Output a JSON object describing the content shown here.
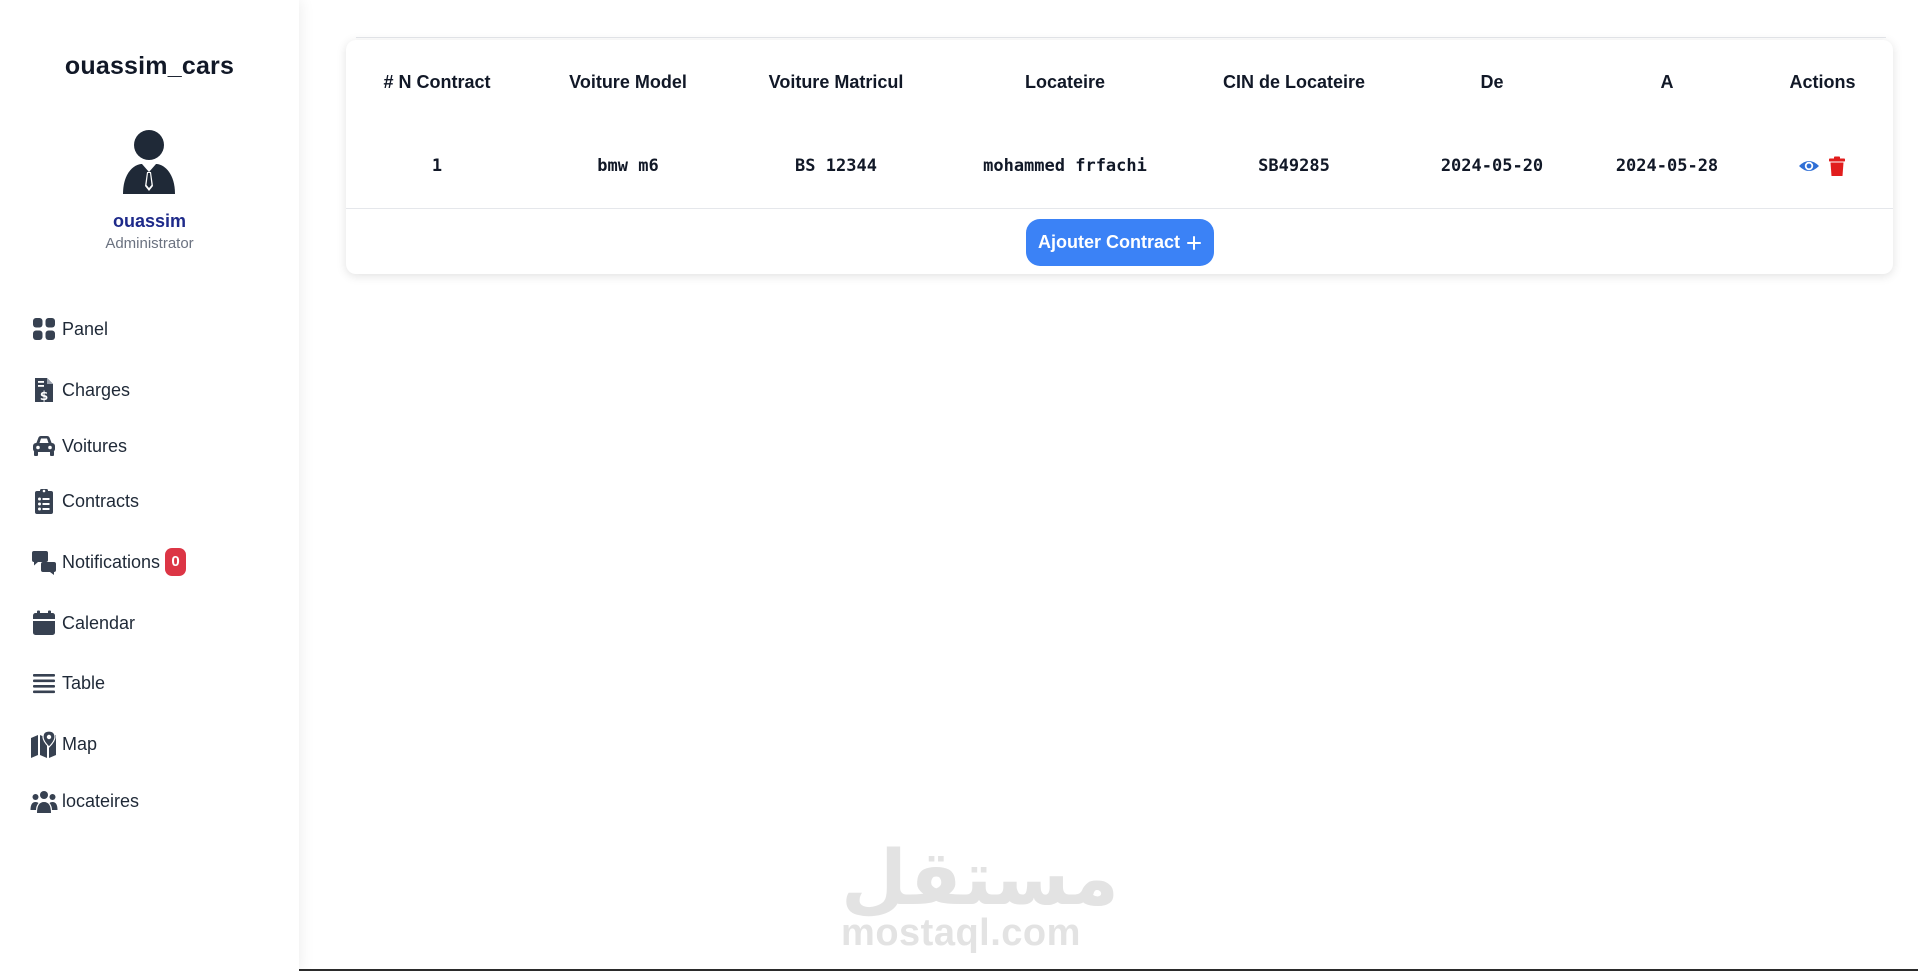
{
  "app": {
    "brand": "ouassim_cars"
  },
  "user": {
    "name": "ouassim",
    "role": "Administrator"
  },
  "sidebar": {
    "items": [
      {
        "label": "Panel",
        "icon": "grid-icon"
      },
      {
        "label": "Charges",
        "icon": "invoice-dollar-icon"
      },
      {
        "label": "Voitures",
        "icon": "car-icon"
      },
      {
        "label": "Contracts",
        "icon": "clipboard-list-icon"
      },
      {
        "label": "Notifications",
        "icon": "comments-icon",
        "badge": "0"
      },
      {
        "label": "Calendar",
        "icon": "calendar-icon"
      },
      {
        "label": "Table",
        "icon": "list-lines-icon"
      },
      {
        "label": "Map",
        "icon": "map-location-icon"
      },
      {
        "label": "locateires",
        "icon": "users-icon"
      }
    ]
  },
  "table": {
    "headers": [
      "# N Contract",
      "Voiture Model",
      "Voiture Matricul",
      "Locateire",
      "CIN de Locateire",
      "De",
      "A",
      "Actions"
    ],
    "rows": [
      [
        "1",
        "bmw m6",
        "BS 12344",
        "mohammed frfachi",
        "SB49285",
        "2024-05-20",
        "2024-05-28"
      ]
    ],
    "actions": [
      "eye-icon",
      "trash-icon"
    ]
  },
  "buttons": {
    "add_contract": "Ajouter Contract"
  },
  "watermark": {
    "arabic": "مستقل",
    "latin": "mostaql.com"
  },
  "colors": {
    "accent": "#3b82f6",
    "badge": "#dc3545",
    "user_name": "#1e2a8a",
    "view_icon": "#2f6fd6",
    "delete_icon": "#e11d1d"
  }
}
